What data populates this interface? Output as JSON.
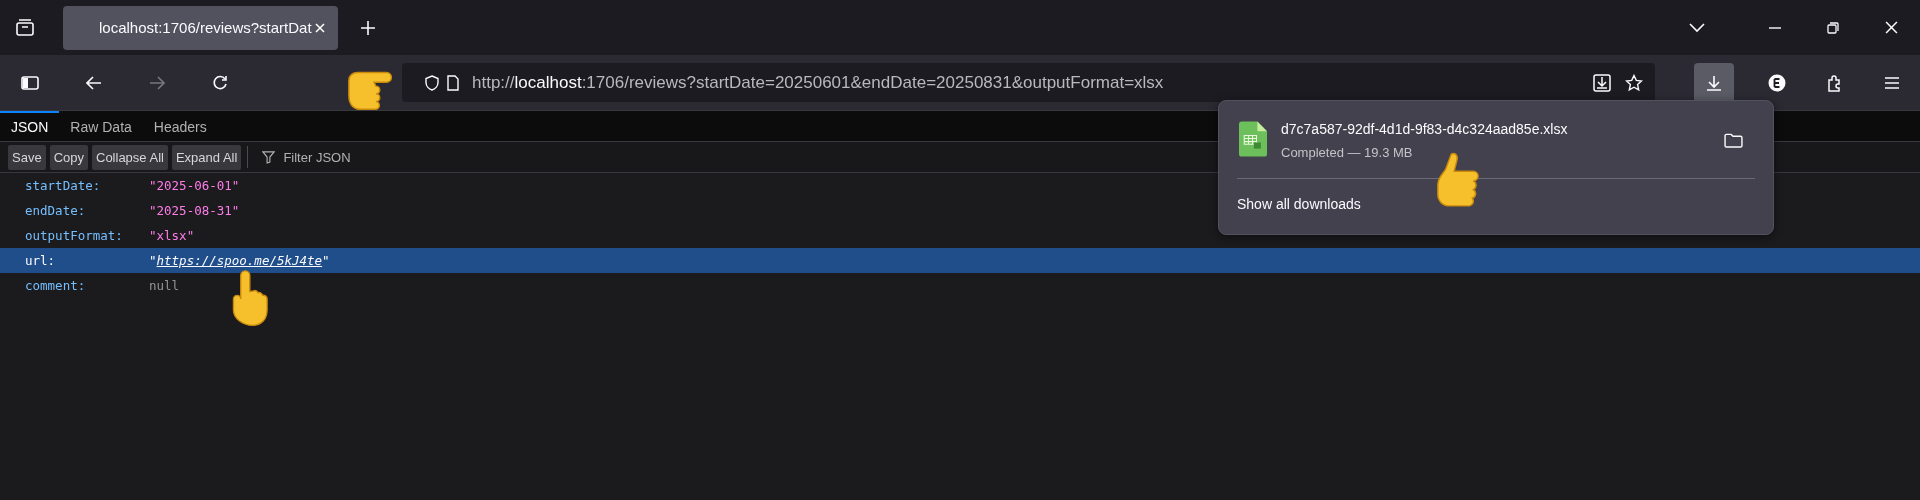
{
  "tabs": [
    {
      "title": "localhost:1706/reviews?startDat",
      "selected": true
    }
  ],
  "address": {
    "scheme": "http://",
    "host": "localhost",
    "rest": ":1706/reviews?startDate=20250601&endDate=20250831&outputFormat=xlsx"
  },
  "viewer_tabs": [
    {
      "label": "JSON",
      "selected": true
    },
    {
      "label": "Raw Data",
      "selected": false
    },
    {
      "label": "Headers",
      "selected": false
    }
  ],
  "viewer_toolbar": {
    "buttons": [
      "Save",
      "Copy",
      "Collapse All",
      "Expand All"
    ],
    "filter": {
      "placeholder": "Filter JSON"
    }
  },
  "rows": [
    {
      "key": "startDate:",
      "value": "\"2025-06-01\"",
      "kind": "string",
      "selected": false
    },
    {
      "key": "endDate:",
      "value": "\"2025-08-31\"",
      "kind": "string",
      "selected": false
    },
    {
      "key": "outputFormat:",
      "value": "\"xlsx\"",
      "kind": "string",
      "selected": false
    },
    {
      "key": "url:",
      "value": "https://spoo.me/5kJ4te",
      "open_quote": "\"",
      "close_quote": "\"",
      "kind": "link",
      "selected": true
    },
    {
      "key": "comment:",
      "value": "null",
      "kind": "null",
      "selected": false
    }
  ],
  "downloads_panel": {
    "file_name": "d7c7a587-92df-4d1d-9f83-d4c324aad85e.xlsx",
    "status": "Completed — 19.3 MB",
    "show_all": "Show all downloads"
  }
}
